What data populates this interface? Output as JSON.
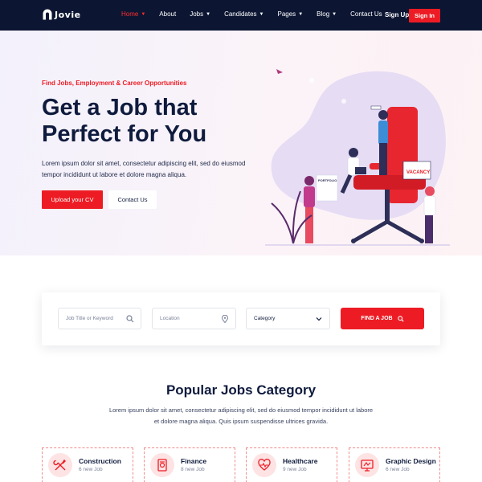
{
  "brand": {
    "name": "Jovie"
  },
  "nav": {
    "items": [
      {
        "label": "Home",
        "active": true,
        "dropdown": true
      },
      {
        "label": "About",
        "active": false,
        "dropdown": false
      },
      {
        "label": "Jobs",
        "active": false,
        "dropdown": true
      },
      {
        "label": "Candidates",
        "active": false,
        "dropdown": true
      },
      {
        "label": "Pages",
        "active": false,
        "dropdown": true
      },
      {
        "label": "Blog",
        "active": false,
        "dropdown": true
      },
      {
        "label": "Contact Us",
        "active": false,
        "dropdown": false
      }
    ],
    "signup_label": "Sign Up",
    "signin_label": "Sign In"
  },
  "hero": {
    "tagline": "Find Jobs, Employment & Career Opportunities",
    "title_line1": "Get a Job that",
    "title_line2": "Perfect for You",
    "description": "Lorem ipsum dolor sit amet, consectetur adipiscing elit, sed do eiusmod tempor incididunt ut labore et dolore magna aliqua.",
    "upload_label": "Upload your CV",
    "contact_label": "Contact Us",
    "illustration": {
      "vacancy_sign": "VACANCY",
      "portfolio_label": "PORTFOLIO"
    }
  },
  "search": {
    "keyword_placeholder": "Job Title or Keyword",
    "location_placeholder": "Location",
    "category_value": "Category",
    "find_label": "FIND A JOB"
  },
  "popular": {
    "title": "Popular Jobs Category",
    "description": "Lorem ipsum dolor sit amet, consectetur adipiscing elit, sed do eiusmod tempor incididunt ut labore et dolore magna aliqua. Quis ipsum suspendisse ultrices gravida.",
    "categories": [
      {
        "name": "Construction",
        "count": "6 new Job",
        "icon": "tools-icon"
      },
      {
        "name": "Finance",
        "count": "8 new Job",
        "icon": "finance-icon"
      },
      {
        "name": "Healthcare",
        "count": "9 new Job",
        "icon": "heart-pulse-icon"
      },
      {
        "name": "Graphic Design",
        "count": "6 new Job",
        "icon": "design-icon"
      }
    ]
  },
  "colors": {
    "accent": "#ed1c24",
    "navy": "#0c1633",
    "text": "#0f1b3d"
  }
}
